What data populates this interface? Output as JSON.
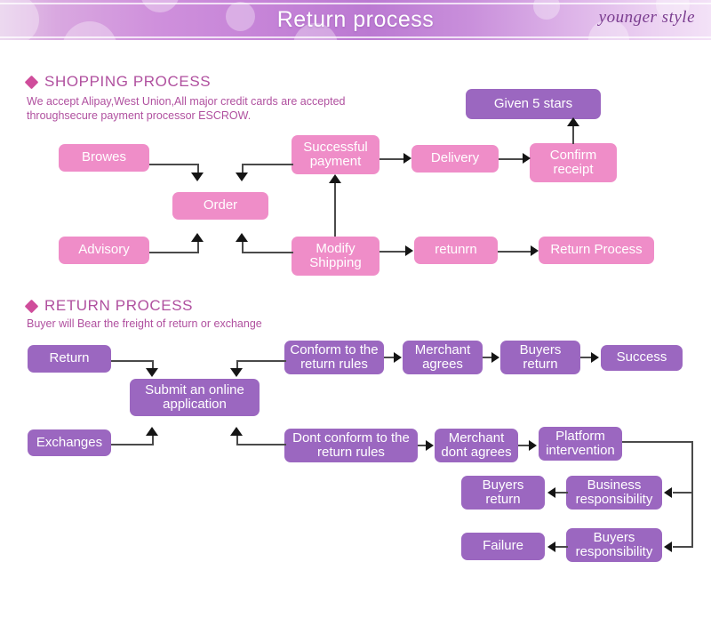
{
  "banner": {
    "title": "Return process",
    "logo": "younger style"
  },
  "shopping_section": {
    "heading": "SHOPPING PROCESS",
    "subtitle": "We accept Alipay,West Union,All major credit cards are accepted\nthroughsecure payment processor ESCROW.",
    "boxes": [
      {
        "label": "Browes"
      },
      {
        "label": "Order"
      },
      {
        "label": "Advisory"
      },
      {
        "label": "Successful\npayment"
      },
      {
        "label": "Modify\nShipping"
      },
      {
        "label": "Delivery"
      },
      {
        "label": "Confirm\nreceipt"
      },
      {
        "label": "Given 5 stars"
      },
      {
        "label": "retunrn"
      },
      {
        "label": "Return Process"
      }
    ]
  },
  "return_section": {
    "heading": "RETURN PROCESS",
    "subtitle": "Buyer will Bear the freight of return or exchange",
    "boxes": [
      {
        "label": "Return"
      },
      {
        "label": "Exchanges"
      },
      {
        "label": "Submit an online\napplication"
      },
      {
        "label": "Conform to the\nreturn rules"
      },
      {
        "label": "Merchant\nagrees"
      },
      {
        "label": "Buyers\nreturn"
      },
      {
        "label": "Success"
      },
      {
        "label": "Dont conform to the\nreturn rules"
      },
      {
        "label": "Merchant\ndont agrees"
      },
      {
        "label": "Platform\nintervention"
      },
      {
        "label": "Business\nresponsibility"
      },
      {
        "label": "Buyers\nreturn"
      },
      {
        "label": "Buyers\nresponsibility"
      },
      {
        "label": "Failure"
      }
    ]
  },
  "colors": {
    "pink": "#ef8dc8",
    "purple": "#9b67c0",
    "heading": "#b0509f",
    "connector": "#4a4a4a"
  }
}
